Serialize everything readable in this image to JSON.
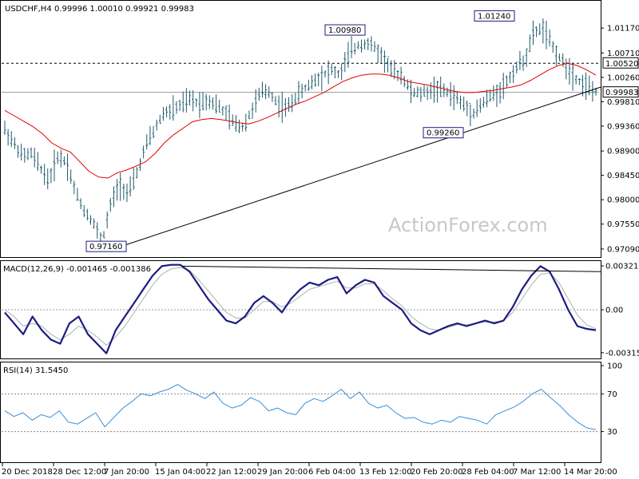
{
  "header": {
    "symbol": "USDCHF,H4",
    "ohlc": "0.99996 1.00010 0.99921 0.99983"
  },
  "watermark": "ActionForex.com",
  "colors": {
    "candle": "#1f5a6b",
    "ma": "#e00000",
    "macd": "#1c1c80",
    "signal": "#b0b0b0",
    "rsi": "#3a8fd8",
    "trendline": "#000000",
    "dotted": "#000000"
  },
  "chart_data": [
    {
      "type": "candlestick",
      "title": "USDCHF,H4",
      "y_ticks": [
        "1.01170",
        "1.00710",
        "1.00260",
        "0.99810",
        "0.99360",
        "0.98900",
        "0.98450",
        "0.98000",
        "0.97550",
        "0.97090"
      ],
      "ylim": [
        0.97,
        1.016
      ],
      "price_labels": [
        {
          "label": "1.00520",
          "value": 1.0052
        },
        {
          "label": "0.99983",
          "value": 0.99983
        }
      ],
      "annotations": [
        {
          "label": "0.97160",
          "value": 0.9716
        },
        {
          "label": "1.00980",
          "value": 1.0098
        },
        {
          "label": "0.99260",
          "value": 0.9926
        },
        {
          "label": "1.01240",
          "value": 1.0124
        }
      ],
      "horizontal_level": 1.0052,
      "trendline": {
        "from": 0.9717,
        "to": 1.0008
      },
      "price_path": [
        0.993,
        0.9905,
        0.988,
        0.9885,
        0.986,
        0.9835,
        0.988,
        0.987,
        0.9815,
        0.978,
        0.976,
        0.972,
        0.979,
        0.983,
        0.981,
        0.985,
        0.99,
        0.993,
        0.996,
        0.9965,
        0.9975,
        0.9985,
        0.9978,
        0.9985,
        0.9975,
        0.996,
        0.994,
        0.9935,
        0.9965,
        0.9998,
        1.0,
        0.9975,
        0.9968,
        0.999,
        1.0005,
        1.002,
        1.003,
        1.004,
        1.003,
        1.007,
        1.0085,
        1.009,
        1.008,
        1.006,
        1.0035,
        1.003,
        1.0,
        0.9995,
        1.0,
        1.0005,
        1.0,
        0.999,
        0.9975,
        0.996,
        0.9975,
        0.999,
        1.0,
        1.002,
        1.0045,
        1.006,
        1.011,
        1.0115,
        1.0085,
        1.006,
        1.004,
        1.002,
        1.001,
        0.9998
      ],
      "ma_path": [
        0.9965,
        0.9955,
        0.9945,
        0.9935,
        0.9922,
        0.9905,
        0.9895,
        0.9888,
        0.987,
        0.9852,
        0.9842,
        0.984,
        0.985,
        0.9855,
        0.9862,
        0.987,
        0.9885,
        0.9905,
        0.992,
        0.9932,
        0.9944,
        0.9948,
        0.995,
        0.9948,
        0.9945,
        0.9942,
        0.994,
        0.9945,
        0.9952,
        0.996,
        0.9968,
        0.9976,
        0.9982,
        0.999,
        0.9998,
        1.0008,
        1.0018,
        1.0025,
        1.003,
        1.0032,
        1.0032,
        1.003,
        1.0025,
        1.0018,
        1.0015,
        1.0012,
        1.0008,
        1.0004,
        1.0,
        0.9998,
        0.9998,
        1.0,
        1.0002,
        1.0005,
        1.0008,
        1.0012,
        1.002,
        1.003,
        1.004,
        1.0048,
        1.0052,
        1.0048,
        1.004,
        1.003
      ]
    },
    {
      "type": "line",
      "title": "MACD(12,26,9) -0.001465 -0.001386",
      "y_ticks": [
        "0.003219",
        "0.00",
        "-0.003153"
      ],
      "ylim": [
        -0.0034,
        0.0034
      ],
      "zero_label": "0.00",
      "macd": [
        -0.0002,
        -0.001,
        -0.0018,
        -0.0005,
        -0.0015,
        -0.0022,
        -0.0025,
        -0.001,
        -0.0005,
        -0.0018,
        -0.0025,
        -0.0032,
        -0.0015,
        -0.0005,
        0.0005,
        0.0015,
        0.0025,
        0.0032,
        0.0033,
        0.0033,
        0.0028,
        0.0018,
        0.0008,
        0.0,
        -0.0008,
        -0.001,
        -0.0005,
        0.0005,
        0.001,
        0.0005,
        -0.0002,
        0.0008,
        0.0015,
        0.002,
        0.0018,
        0.0022,
        0.0024,
        0.0012,
        0.0018,
        0.0022,
        0.002,
        0.001,
        0.0005,
        0.0,
        -0.001,
        -0.0015,
        -0.0018,
        -0.0015,
        -0.0012,
        -0.001,
        -0.0012,
        -0.001,
        -0.0008,
        -0.001,
        -0.0008,
        0.0002,
        0.0015,
        0.0025,
        0.0032,
        0.0028,
        0.0015,
        0.0,
        -0.0012,
        -0.0014,
        -0.0015
      ],
      "signal": [
        0.0,
        -0.0005,
        -0.0012,
        -0.001,
        -0.0012,
        -0.0018,
        -0.0022,
        -0.0018,
        -0.0012,
        -0.0015,
        -0.002,
        -0.0026,
        -0.002,
        -0.0012,
        -0.0002,
        0.0008,
        0.0018,
        0.0026,
        0.003,
        0.0031,
        0.0029,
        0.0022,
        0.0014,
        0.0006,
        -0.0002,
        -0.0006,
        -0.0006,
        0.0,
        0.0006,
        0.0006,
        0.0002,
        0.0005,
        0.001,
        0.0015,
        0.0017,
        0.0019,
        0.0021,
        0.0016,
        0.0016,
        0.0019,
        0.0019,
        0.0014,
        0.0008,
        0.0003,
        -0.0005,
        -0.001,
        -0.0014,
        -0.0015,
        -0.0013,
        -0.0011,
        -0.0011,
        -0.001,
        -0.0009,
        -0.0009,
        -0.0008,
        -0.0002,
        0.0008,
        0.0018,
        0.0026,
        0.0027,
        0.002,
        0.0008,
        -0.0004,
        -0.0011,
        -0.0014
      ],
      "upper_trend": {
        "from": 0.0032,
        "to": 0.0028
      }
    },
    {
      "type": "line",
      "title": "RSI(14) 31.5450",
      "y_ticks": [
        "100",
        "70",
        "30"
      ],
      "ylim": [
        0,
        100
      ],
      "levels": [
        70,
        30
      ],
      "values": [
        52,
        46,
        50,
        42,
        48,
        45,
        52,
        40,
        38,
        44,
        50,
        35,
        45,
        55,
        62,
        70,
        68,
        72,
        75,
        80,
        74,
        70,
        65,
        72,
        60,
        55,
        58,
        66,
        62,
        52,
        55,
        50,
        48,
        60,
        65,
        62,
        68,
        75,
        65,
        72,
        60,
        55,
        58,
        50,
        44,
        45,
        40,
        38,
        42,
        40,
        46,
        44,
        42,
        38,
        48,
        52,
        56,
        62,
        70,
        75,
        66,
        58,
        48,
        40,
        34,
        32
      ]
    }
  ],
  "x_ticks": [
    "20 Dec 2018",
    "28 Dec 12:00",
    "7 Jan 20:00",
    "15 Jan 04:00",
    "22 Jan 12:00",
    "29 Jan 20:00",
    "6 Feb 04:00",
    "13 Feb 12:00",
    "20 Feb 20:00",
    "28 Feb 04:00",
    "7 Mar 12:00",
    "14 Mar 20:00"
  ]
}
